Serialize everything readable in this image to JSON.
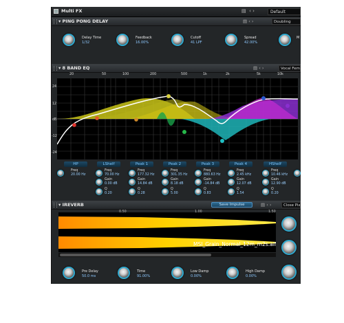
{
  "window": {
    "title": "Multi FX",
    "preset": "Default"
  },
  "ppdelay": {
    "title": "PING PONG DELAY",
    "preset": "Doubling",
    "knobs": [
      {
        "label": "Delay Time",
        "value": "1/32"
      },
      {
        "label": "Feedback",
        "value": "16.00%"
      },
      {
        "label": "Cutoff",
        "value": "41 LPF"
      },
      {
        "label": "Spread",
        "value": "42.00%"
      },
      {
        "label": "M",
        "value": ""
      }
    ]
  },
  "eq": {
    "title": "8 BAND EQ",
    "preset": "Vocal Femu",
    "freq_labels": [
      "10",
      "20",
      "50",
      "100",
      "200",
      "500",
      "1k",
      "2k",
      "5k",
      "10k",
      "20k"
    ],
    "db_labels": [
      "24",
      "12",
      "dB",
      "-12",
      "-24"
    ],
    "bands": [
      {
        "name": "HP",
        "freq": "20.00 Hz"
      },
      {
        "name": "LShelf",
        "freq": "70.00 Hz",
        "gain": "0.00 dB",
        "q": "0.20"
      },
      {
        "name": "Peak 1",
        "freq": "177.32 Hz",
        "gain": "14.84 dB",
        "q": "0.28"
      },
      {
        "name": "Peak 2",
        "freq": "301.35 Hz",
        "gain": "8.18 dB",
        "q": "5.00"
      },
      {
        "name": "Peak 3",
        "freq": "880.63 Hz",
        "gain": "-14.84 dB",
        "q": "0.83"
      },
      {
        "name": "Peak 4",
        "freq": "2.45 kHz",
        "gain": "12.07 dB",
        "q": "1.54"
      },
      {
        "name": "HShelf",
        "freq": "10.46 kHz",
        "gain": "12.90 dB",
        "q": "0.20"
      }
    ],
    "lbl_freq": "Freq",
    "lbl_gain": "Gain",
    "lbl_q": "Q"
  },
  "ireverb": {
    "title": "IREVERB",
    "save_label": "Save Impulse",
    "preset": "Close Piano",
    "timeline": [
      "0.50",
      "1.00",
      "1.50"
    ],
    "filename": "MSI_Grain_Normal_12m_m2s.aif",
    "knobs": [
      {
        "label": "Pre Delay",
        "value": "50.0 ms"
      },
      {
        "label": "Time",
        "value": "91.00%"
      },
      {
        "label": "Low Damp",
        "value": "0.00%"
      },
      {
        "label": "High Damp",
        "value": "0.00%"
      }
    ]
  },
  "colors": {
    "accent": "#2fa9cf",
    "value_text": "#8ec9ff"
  }
}
